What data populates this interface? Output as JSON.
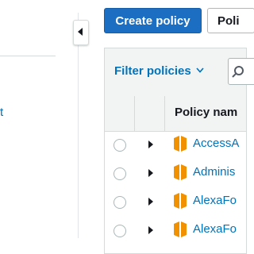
{
  "sidebar": {
    "fragment_text": "t"
  },
  "toolbar": {
    "create_label": "Create policy",
    "secondary_label": "Poli"
  },
  "filter": {
    "label": "Filter policies"
  },
  "table": {
    "header_name": "Policy nam",
    "rows": [
      {
        "name": "AccessA"
      },
      {
        "name": "Adminis"
      },
      {
        "name": "AlexaFo"
      },
      {
        "name": "AlexaFo"
      }
    ]
  },
  "colors": {
    "primary": "#1b6ec2",
    "link": "#0073bb",
    "policy_icon": "#f29100"
  }
}
